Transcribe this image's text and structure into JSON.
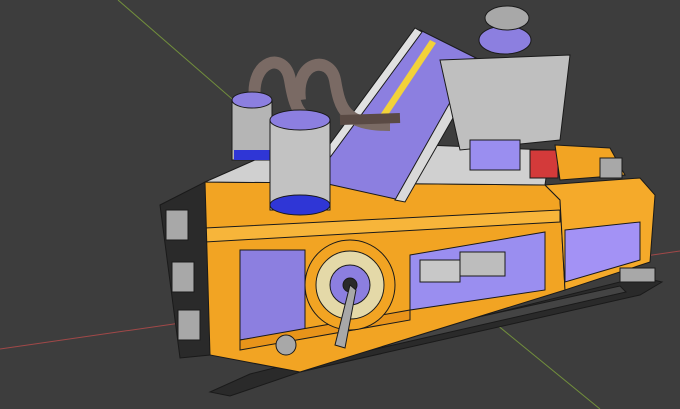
{
  "viewport": {
    "background": "#3d3d3d",
    "grid_axis_x_color": "#b34a4a",
    "grid_axis_y_color": "#7fa33c"
  },
  "model": {
    "primary_color": "#f2a423",
    "secondary_color": "#8c7fe0",
    "dark_color": "#2a2a2a",
    "metal_color": "#a8a8a8",
    "accent_blue": "#2f36d6",
    "accent_red": "#d33a3a"
  }
}
